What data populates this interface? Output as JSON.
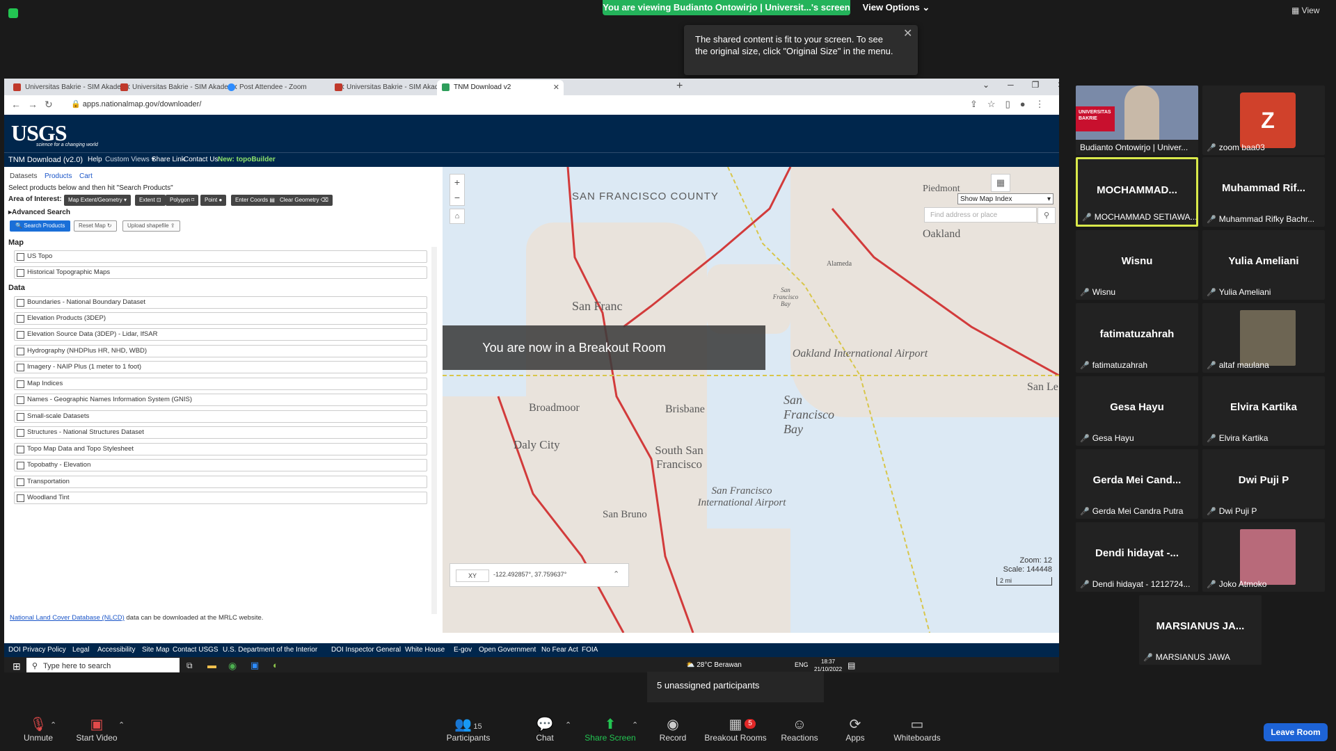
{
  "zoom": {
    "viewing_banner": "You are viewing Budianto Ontowirjo | Universit...'s screen",
    "view_options": "View Options",
    "view_right": "View",
    "tooltip": "The shared content is fit to your screen. To see the original size, click \"Original Size\" in the menu.",
    "breakout_message": "You are now in a Breakout Room",
    "unassigned": "5 unassigned participants",
    "leave_room": "Leave Room"
  },
  "browser": {
    "tabs": [
      {
        "label": "Universitas Bakrie - SIM Akadem"
      },
      {
        "label": "Universitas Bakrie - SIM Akadem"
      },
      {
        "label": "Post Attendee - Zoom"
      },
      {
        "label": "Universitas Bakrie - SIM Akadem"
      },
      {
        "label": "TNM Download v2"
      }
    ],
    "url": "apps.nationalmap.gov/downloader/"
  },
  "usgs": {
    "logo": "USGS",
    "tagline": "science for a changing world",
    "nav": {
      "title": "TNM Download (v2.0)",
      "help": "Help",
      "custom_views": "Custom Views ▾",
      "share_link": "Share Link",
      "contact": "Contact Us",
      "topobuilder": "New: topoBuilder"
    },
    "panel_tabs": [
      "Datasets",
      "Products",
      "Cart"
    ],
    "instructions": "Select products below and then hit \"Search Products\"",
    "area_label": "Area of Interest:",
    "buttons": {
      "map_extent": "Map Extent/Geometry ▾",
      "extent": "Extent ⊡",
      "polygon": "Polygon ⌑",
      "point": "Point ●",
      "enter_coords": "Enter Coords ▤",
      "clear_geometry": "Clear Geometry ⌫",
      "advanced": "Advanced Search",
      "search_products": "Search Products",
      "reset_map": "Reset Map ↻",
      "upload_shapefile": "Upload shapefile ⇪"
    },
    "sections": {
      "map": "Map",
      "data": "Data"
    },
    "map_items": [
      "US Topo",
      "Historical Topographic Maps"
    ],
    "data_items": [
      "Boundaries - National Boundary Dataset",
      "Elevation Products (3DEP)",
      "Elevation Source Data (3DEP) - Lidar, IfSAR",
      "Hydrography (NHDPlus HR, NHD, WBD)",
      "Imagery - NAIP Plus (1 meter to 1 foot)",
      "Map Indices",
      "Names - Geographic Names Information System (GNIS)",
      "Small-scale Datasets",
      "Structures - National Structures Dataset",
      "Topo Map Data and Topo Stylesheet",
      "Topobathy - Elevation",
      "Transportation",
      "Woodland Tint"
    ],
    "nlcd_link": "National Land Cover Database (NLCD)",
    "nlcd_text": " data can be downloaded at the MRLC website.",
    "map": {
      "index_select": "Show Map Index",
      "search_placeholder": "Find address or place",
      "labels": {
        "sf_county": "SAN FRANCISCO COUNTY",
        "oakland": "Oakland",
        "piedmont": "Piedmont",
        "alameda": "Alameda",
        "sf_bay_small": "San Francisco Bay",
        "sf": "San Franc",
        "oakland_airport": "Oakland International Airport",
        "sf_bay": "San Francisco Bay",
        "san_le": "San Le",
        "broadmoor": "Broadmoor",
        "daly_city": "Daly City",
        "brisbane": "Brisbane",
        "south_sf": "South San Francisco",
        "sfo": "San Francisco International Airport",
        "san_bruno": "San Bruno"
      },
      "zoom": "Zoom: 12",
      "scale": "Scale: 144448",
      "scalebar": "2 mi",
      "coord_mode": "XY",
      "coords": "-122.492857°, 37.759637°"
    },
    "footer": [
      "DOI Privacy Policy",
      "Legal",
      "Accessibility",
      "Site Map",
      "Contact USGS",
      "U.S. Department of the Interior",
      "DOI Inspector General",
      "White House",
      "E-gov",
      "Open Government",
      "No Fear Act",
      "FOIA"
    ]
  },
  "taskbar": {
    "search": "Type here to search",
    "weather": "28°C  Berawan",
    "lang": "ENG",
    "time": "18:37",
    "date": "21/10/2022"
  },
  "participants": [
    {
      "big": "",
      "name": "Budianto Ontowirjo | Univer..."
    },
    {
      "big": "Z",
      "name": "zoom baa03"
    },
    {
      "big": "MOCHAMMAD...",
      "name": "MOCHAMMAD SETIAWA..."
    },
    {
      "big": "Muhammad Rif...",
      "name": "Muhammad Rifky Bachr..."
    },
    {
      "big": "Wisnu",
      "name": "Wisnu"
    },
    {
      "big": "Yulia Ameliani",
      "name": "Yulia Ameliani"
    },
    {
      "big": "fatimatuzahrah",
      "name": "fatimatuzahrah"
    },
    {
      "big": "",
      "name": "altaf maulana"
    },
    {
      "big": "Gesa Hayu",
      "name": "Gesa Hayu"
    },
    {
      "big": "Elvira Kartika",
      "name": "Elvira Kartika"
    },
    {
      "big": "Gerda Mei Cand...",
      "name": "Gerda Mei Candra Putra"
    },
    {
      "big": "Dwi Puji P",
      "name": "Dwi Puji P"
    },
    {
      "big": "Dendi hidayat -...",
      "name": "Dendi hidayat - 1212724..."
    },
    {
      "big": "",
      "name": "Joko Atmoko"
    },
    {
      "big": "MARSIANUS JA...",
      "name": "MARSIANUS JAWA"
    }
  ],
  "presenter_overlay": "UNIVERSITAS BAKRIE",
  "controls": {
    "unmute": "Unmute",
    "start_video": "Start Video",
    "participants": "Participants",
    "participants_count": "15",
    "chat": "Chat",
    "share_screen": "Share Screen",
    "record": "Record",
    "breakout_rooms": "Breakout Rooms",
    "breakout_count": "5",
    "reactions": "Reactions",
    "apps": "Apps",
    "whiteboards": "Whiteboards"
  }
}
